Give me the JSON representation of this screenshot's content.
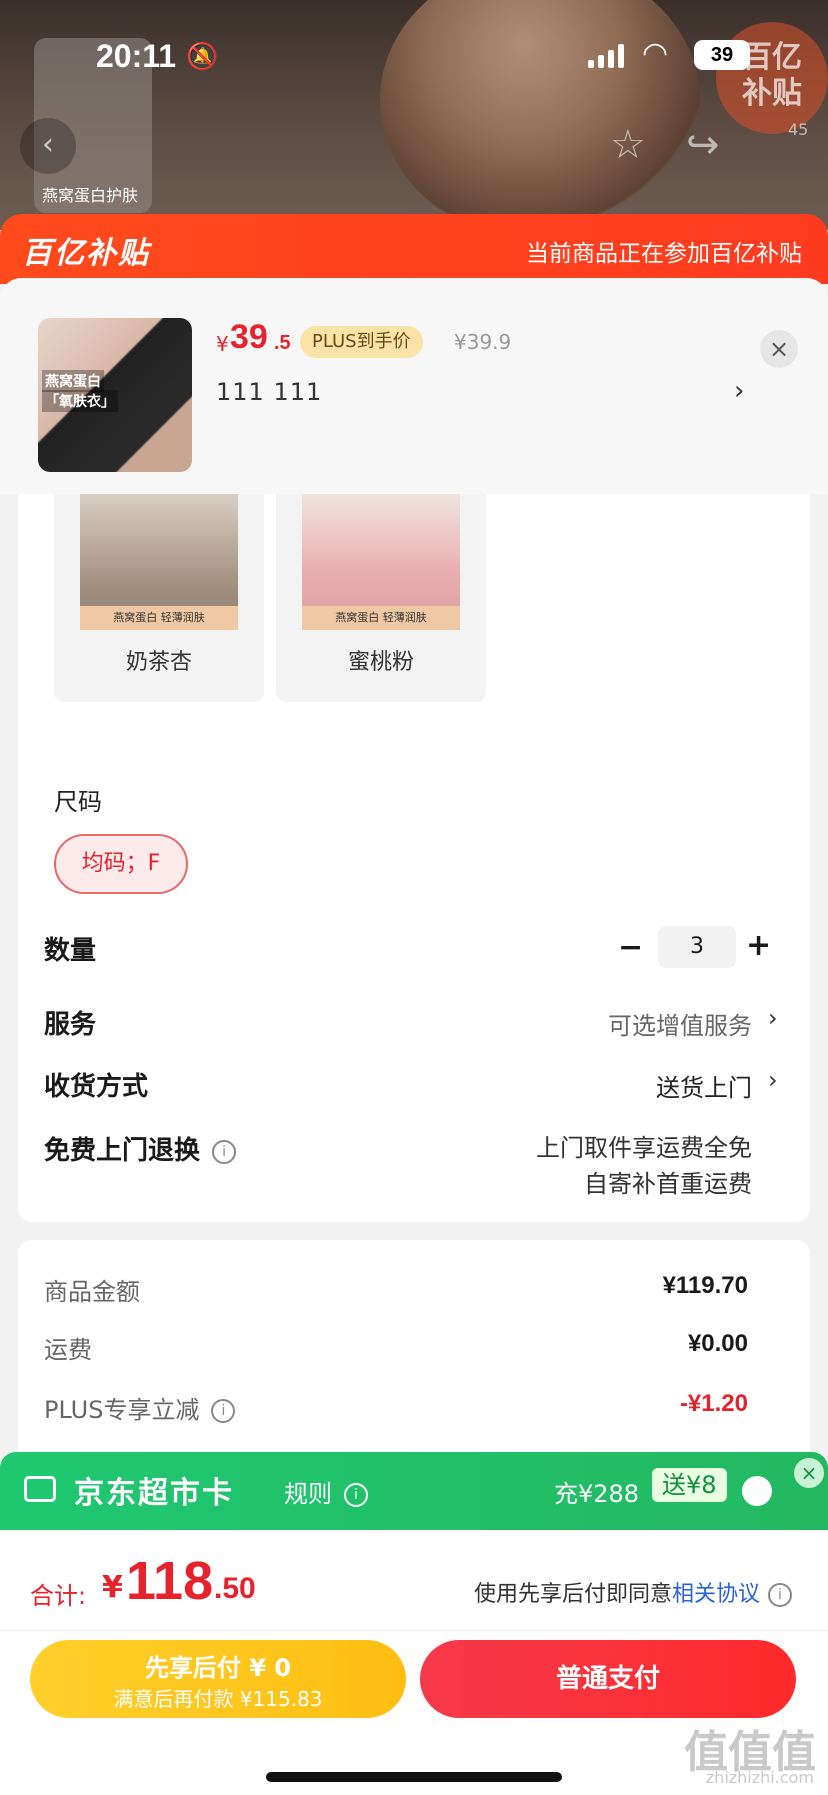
{
  "status_bar": {
    "time": "20:11",
    "battery": "39"
  },
  "background": {
    "thumb_label": "燕窝蛋白护肤",
    "subsidy_badge": "百亿\n补贴",
    "subsidy_count": "45"
  },
  "banner": {
    "logo": "百亿补贴",
    "note": "当前商品正在参加百亿补贴"
  },
  "product": {
    "price_currency": "¥",
    "price_int": "39",
    "price_dec": ".5",
    "plus_tag": "PLUS到手价",
    "original_price": "¥39.9",
    "spec": "111  111",
    "close": "×",
    "image_text_1": "燕窝蛋白",
    "image_text_2": "「氧肤衣」"
  },
  "colors": [
    {
      "label": "奶茶杏",
      "strip": "燕窝蛋白 轻薄润肤",
      "swatch": "#a89684"
    },
    {
      "label": "蜜桃粉",
      "strip": "燕窝蛋白 轻薄润肤",
      "swatch": "#e9a9a9"
    }
  ],
  "size": {
    "title": "尺码",
    "selected": "均码；F"
  },
  "quantity": {
    "label": "数量",
    "minus": "−",
    "value": "3",
    "plus": "+"
  },
  "service": {
    "label": "服务",
    "value": "可选增值服务"
  },
  "delivery": {
    "label": "收货方式",
    "value": "送货上门"
  },
  "returns": {
    "label": "免费上门退换",
    "line1": "上门取件享运费全免",
    "line2": "自寄补首重运费"
  },
  "summary": {
    "items_label": "商品金额",
    "items_value": "¥119.70",
    "shipping_label": "运费",
    "shipping_value": "¥0.00",
    "plus_label": "PLUS专享立减",
    "plus_value": "-¥1.20"
  },
  "supermarket_card": {
    "title": "京东超市卡",
    "rule": "规则",
    "recharge": "充¥288",
    "gift": "送¥8",
    "close": "×"
  },
  "total": {
    "label": "合计:",
    "currency": "¥",
    "int": "118",
    "dec": ".50",
    "agree_text": "使用先享后付即同意",
    "agree_link": "相关协议"
  },
  "buttons": {
    "pay_later_line1": "先享后付 ¥ 0",
    "pay_later_line2": "满意后再付款 ¥115.83",
    "pay": "普通支付"
  },
  "watermark": {
    "text": "值值值",
    "url": "zhizhizhi.com"
  },
  "colors_theme": {
    "accent_red": "#e6232d",
    "banner": "#ff4a1c",
    "green": "#1fc871",
    "yellow": "#ffc51d"
  }
}
